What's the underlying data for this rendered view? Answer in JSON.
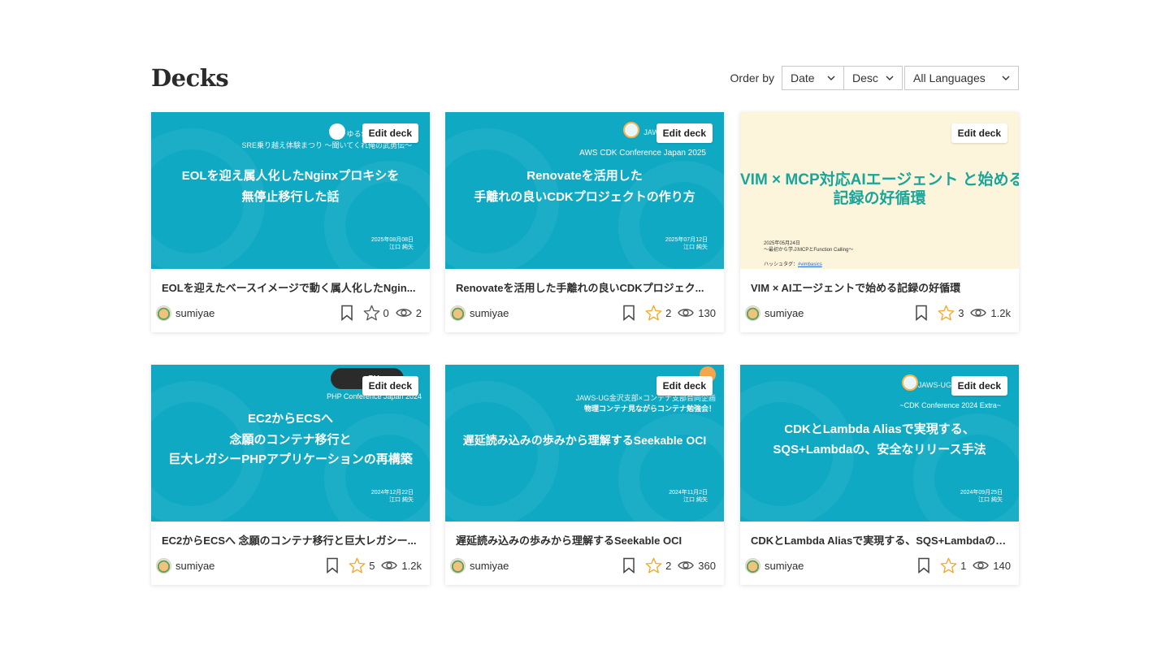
{
  "header": {
    "title": "Decks",
    "order_label": "Order by",
    "sort_field": "Date",
    "sort_direction": "Desc",
    "language": "All Languages"
  },
  "edit_label": "Edit deck",
  "decks": [
    {
      "title": "EOLを迎えたベースイメージで動く属人化したNgin...",
      "author": "sumiyae",
      "stars": "0",
      "views": "2",
      "starred": false,
      "slide": {
        "top": "ゆるSR",
        "sub": "SRE乗り越え体験まつり 〜聞いてくれ俺の武勇伝〜",
        "line1": "EOLを迎え属人化したNginxプロキシを",
        "line2": "無停止移行した話",
        "date": "2025年08月08日",
        "speaker": "江口 純矢"
      }
    },
    {
      "title": "Renovateを活用した手離れの良いCDKプロジェク...",
      "author": "sumiyae",
      "stars": "2",
      "views": "130",
      "starred": true,
      "slide": {
        "top": "JAWS",
        "sub": "AWS CDK Conference Japan 2025",
        "line1": "Renovateを活用した",
        "line2": "手離れの良いCDKプロジェクトの作り方",
        "date": "2025年07月12日",
        "speaker": "江口 純矢"
      }
    },
    {
      "title": "VIM × AIエージェントで始める記録の好循環",
      "author": "sumiyae",
      "stars": "3",
      "views": "1.2k",
      "starred": true,
      "slide": {
        "line1": "VIM × MCP対応AIエージェント と始める",
        "line2": "記録の好循環",
        "note1": "2025年05月24日",
        "note2": "〜最初から学ぶMCPとFunction Calling〜",
        "tag": "ハッシュタグ：",
        "tag_link": "#vimbasics"
      }
    },
    {
      "title": "EC2からECSへ 念願のコンテナ移行と巨大レガシー...",
      "author": "sumiyae",
      "stars": "5",
      "views": "1.2k",
      "starred": true,
      "slide": {
        "top": "PH",
        "sub": "PHP Conference Japan 2024",
        "line1": "EC2からECSへ",
        "line2": "念願のコンテナ移行と",
        "line3": "巨大レガシーPHPアプリケーションの再構築",
        "date": "2024年12月22日",
        "speaker": "江口 純矢"
      }
    },
    {
      "title": "遅延読み込みの歩みから理解するSeekable OCI",
      "author": "sumiyae",
      "stars": "2",
      "views": "360",
      "starred": true,
      "slide": {
        "top": "JAWS-UG金沢支部×コンテナ支部合同企画",
        "sub": "物理コンテナ見ながらコンテナ勉強会！",
        "line1": "遅延読み込みの歩みから理解するSeekable OCI",
        "date": "2024年11月2日",
        "speaker": "江口 純矢"
      }
    },
    {
      "title": "CDKとLambda Aliasで実現する、SQS+Lambdaの、...",
      "author": "sumiyae",
      "stars": "1",
      "views": "140",
      "starred": true,
      "slide": {
        "top": "JAWS-UG C",
        "sub": "~CDK Conference 2024 Extra~",
        "line1": "CDKとLambda Aliasで実現する、",
        "line2": "SQS+Lambdaの、安全なリリース手法",
        "date": "2024年09月25日",
        "speaker": "江口 純矢"
      }
    }
  ],
  "colors": {
    "slide_teal": "#0fa9c4",
    "slide_cream": "#fdf4dc",
    "star_active": "#f5a623",
    "text": "#2e2e2e"
  },
  "icons": [
    "chevron-down-icon",
    "bookmark-icon",
    "star-icon",
    "eye-icon",
    "avatar"
  ]
}
